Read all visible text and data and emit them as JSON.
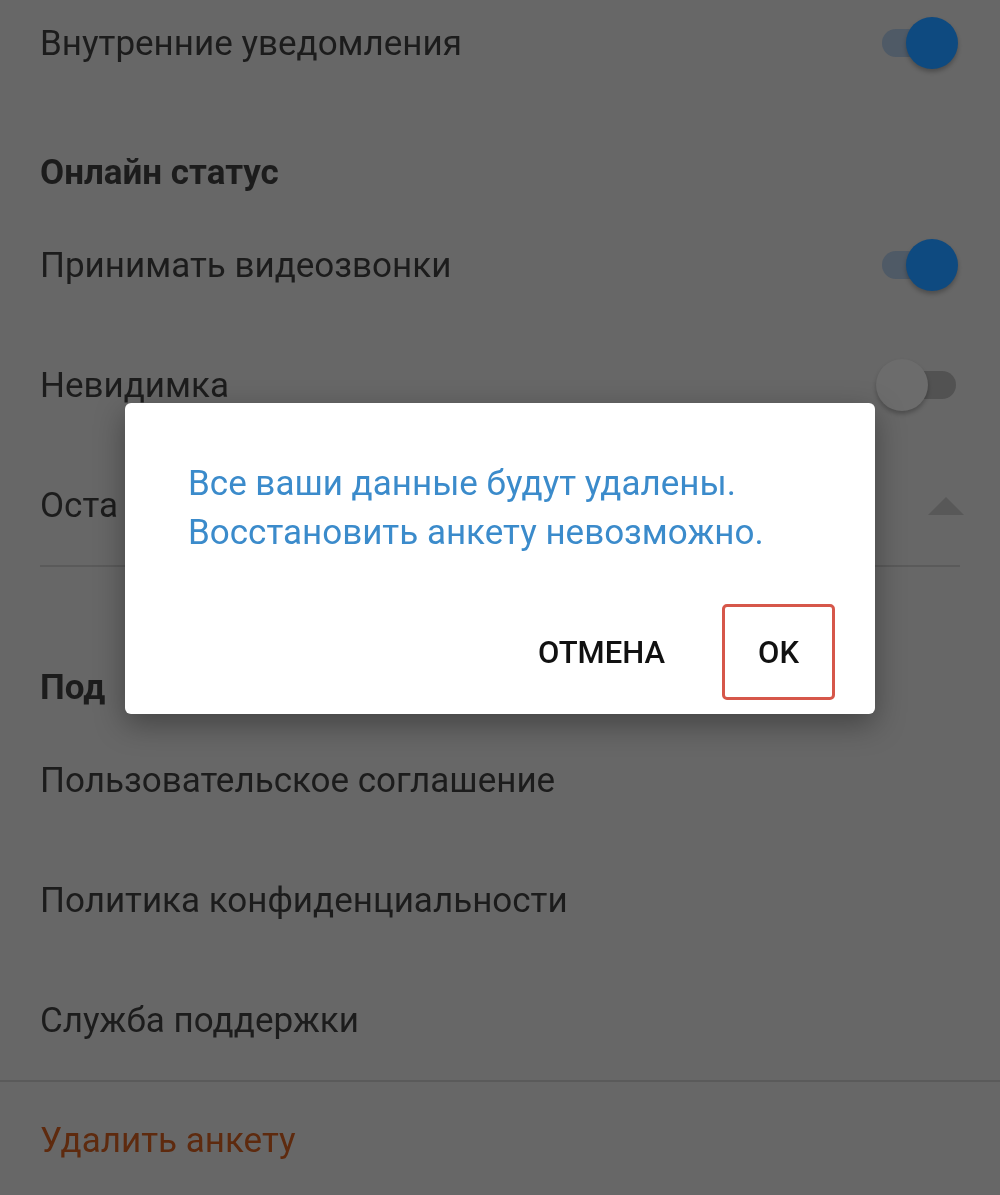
{
  "settings": [
    {
      "kind": "toggle",
      "label": "Внутренние уведомления",
      "on": true
    },
    {
      "kind": "header",
      "label": "Онлайн статус"
    },
    {
      "kind": "toggle",
      "label": "Принимать видеозвонки",
      "on": true
    },
    {
      "kind": "toggle",
      "label": "Невидимка",
      "on": false
    },
    {
      "kind": "expander",
      "label": "Оста",
      "expanded": true
    },
    {
      "kind": "divider"
    },
    {
      "kind": "header",
      "label": "Под"
    },
    {
      "kind": "link",
      "label": "Пользовательское соглашение"
    },
    {
      "kind": "link",
      "label": "Политика конфиденциальности"
    },
    {
      "kind": "link",
      "label": "Служба поддержки"
    },
    {
      "kind": "divider"
    },
    {
      "kind": "danger",
      "label": "Удалить анкету"
    }
  ],
  "dialog": {
    "message": "Все ваши данные будут удалены. Восстановить анкету невозможно.",
    "buttons": [
      {
        "label": "ОТМЕНА",
        "focused": false
      },
      {
        "label": "OK",
        "focused": true
      }
    ]
  }
}
